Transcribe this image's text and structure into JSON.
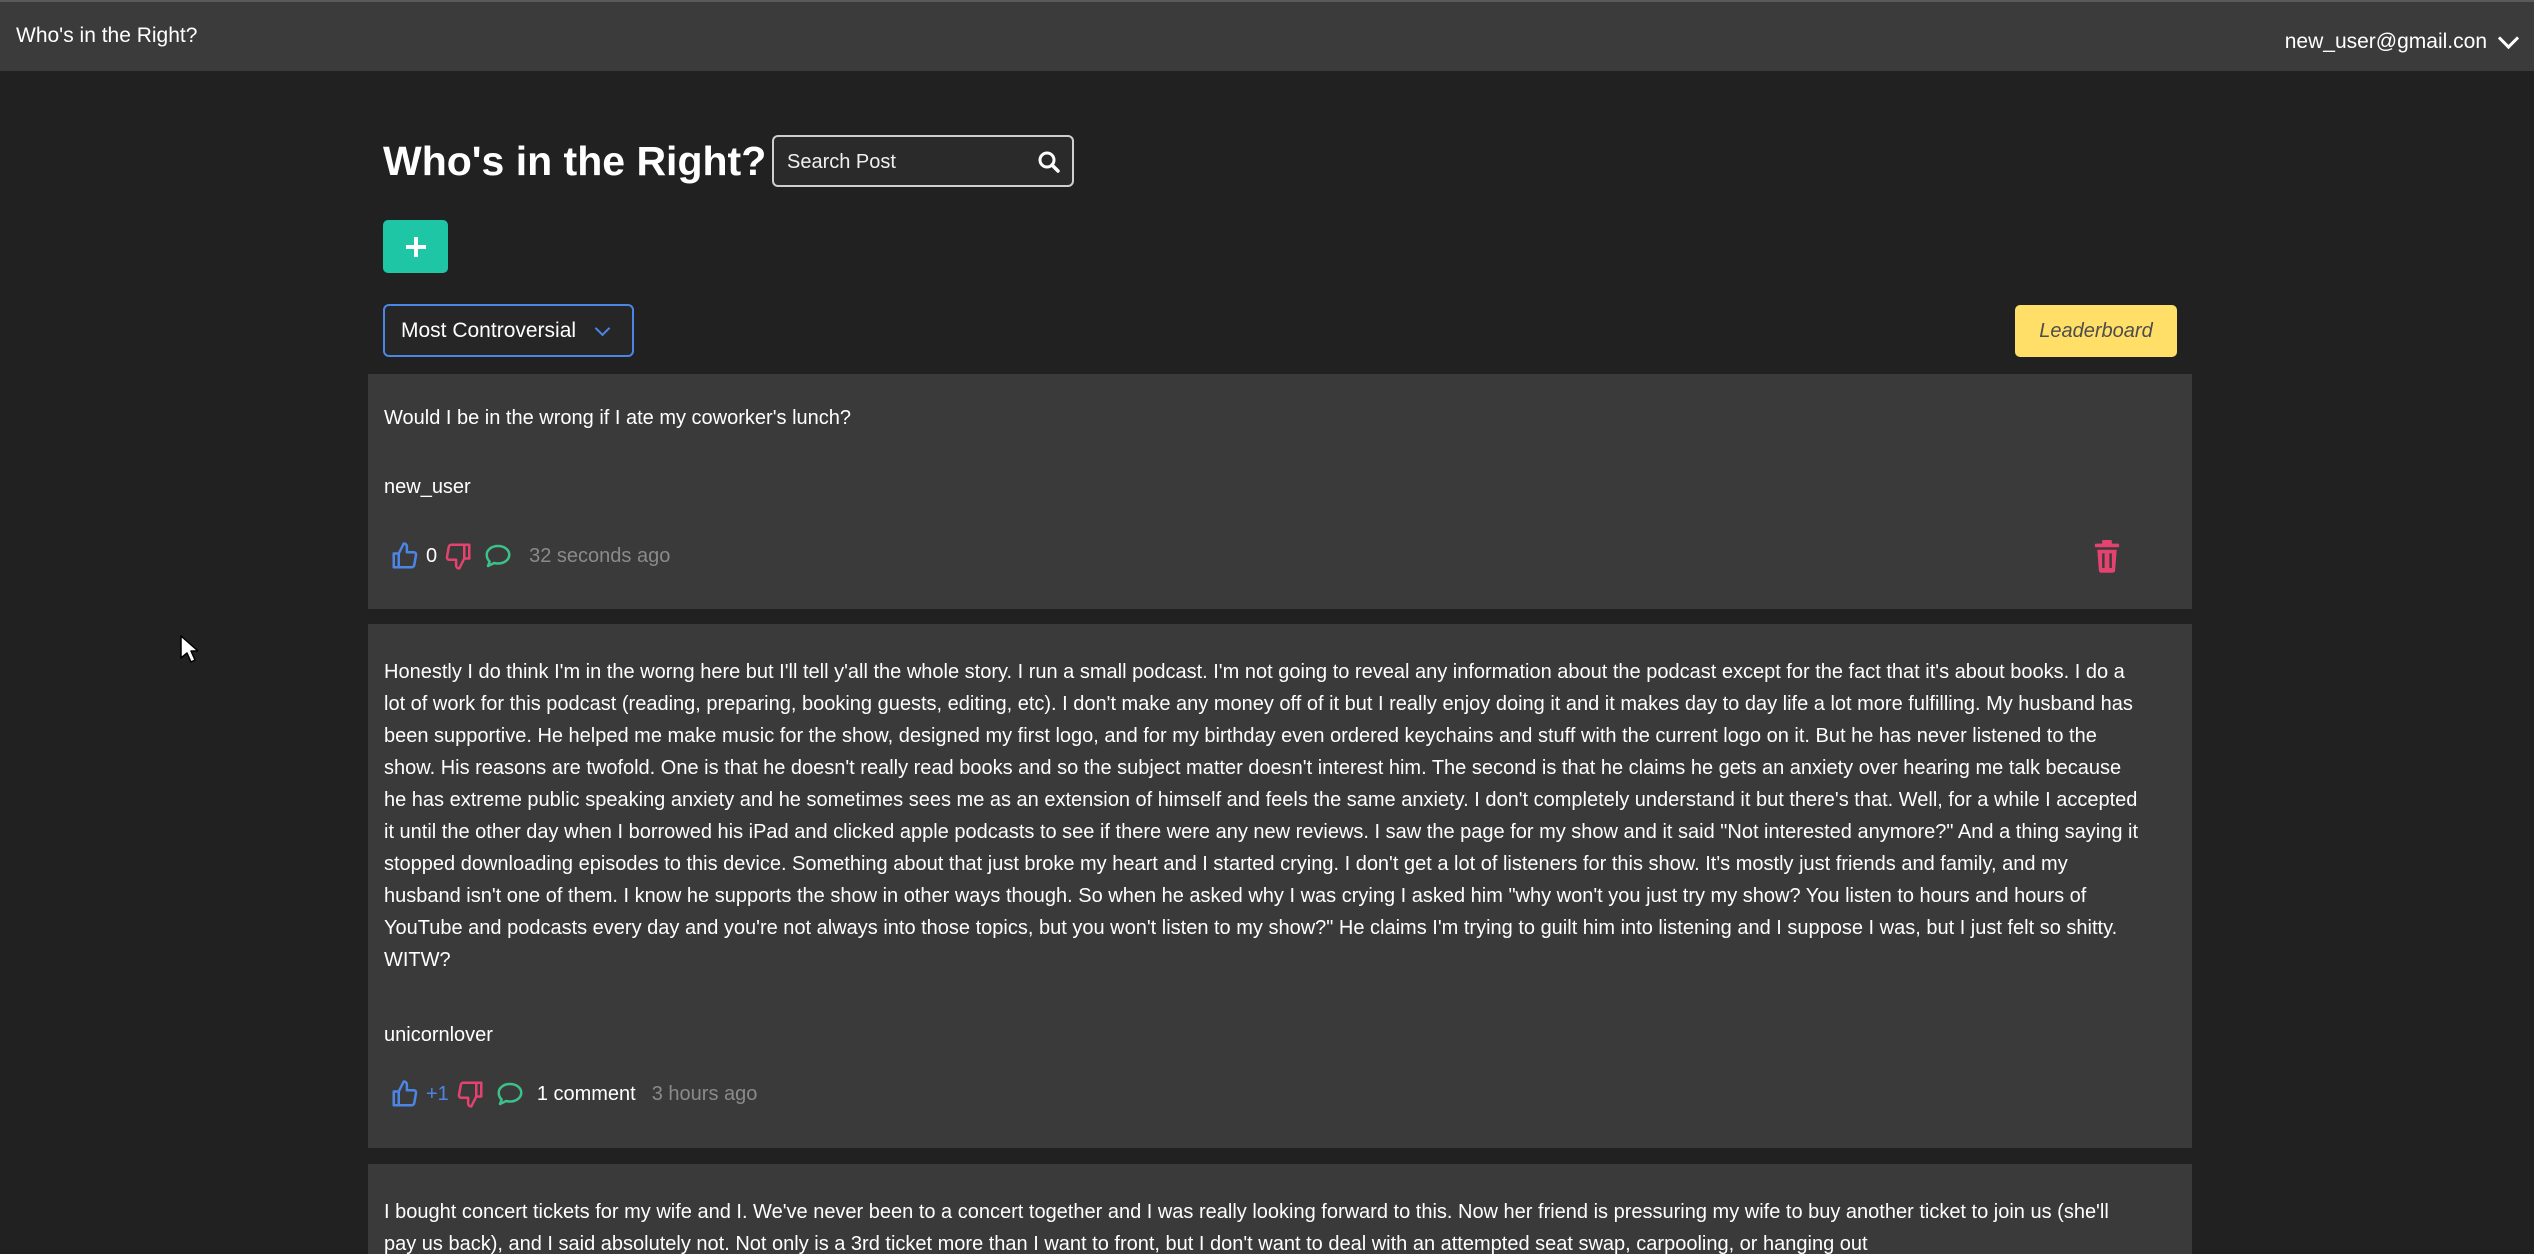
{
  "navbar": {
    "brand": "Who's in the Right?",
    "user_email": "new_user@gmail.con"
  },
  "header": {
    "title": "Who's in the Right?",
    "search_placeholder": "Search Post"
  },
  "controls": {
    "sort_selected": "Most Controversial",
    "leaderboard_label": "Leaderboard"
  },
  "colors": {
    "accent_teal": "#1fc6a5",
    "accent_yellow": "#ffdf68",
    "like_blue": "#4b86e6",
    "dislike_red": "#e4436f",
    "comment_green": "#3cc18a",
    "delete_red": "#e4436f"
  },
  "posts": [
    {
      "body": "Would I be in the wrong if I ate my coworker's lunch?",
      "author": "new_user",
      "score": "0",
      "comments": "",
      "time": "32 seconds ago",
      "deletable": true
    },
    {
      "body": "Honestly I do think I'm in the worng here but I'll tell y'all the whole story. I run a small podcast. I'm not going to reveal any information about the podcast except for the fact that it's about books. I do a lot of work for this podcast (reading, preparing, booking guests, editing, etc). I don't make any money off of it but I really enjoy doing it and it makes day to day life a lot more fulfilling. My husband has been supportive. He helped me make music for the show, designed my first logo, and for my birthday even ordered keychains and stuff with the current logo on it. But he has never listened to the show. His reasons are twofold. One is that he doesn't really read books and so the subject matter doesn't interest him. The second is that he claims he gets an anxiety over hearing me talk because he has extreme public speaking anxiety and he sometimes sees me as an extension of himself and feels the same anxiety. I don't completely understand it but there's that. Well, for a while I accepted it until the other day when I borrowed his iPad and clicked apple podcasts to see if there were any new reviews. I saw the page for my show and it said \"Not interested anymore?\" And a thing saying it stopped downloading episodes to this device. Something about that just broke my heart and I started crying. I don't get a lot of listeners for this show. It's mostly just friends and family, and my husband isn't one of them. I know he supports the show in other ways though. So when he asked why I was crying I asked him \"why won't you just try my show? You listen to hours and hours of YouTube and podcasts every day and you're not always into those topics, but you won't listen to my show?\" He claims I'm trying to guilt him into listening and I suppose I was, but I just felt so shitty. WITW?",
      "author": "unicornlover",
      "score": "+1",
      "comments": "1 comment",
      "time": "3 hours ago",
      "deletable": false
    },
    {
      "body": "I bought concert tickets for my wife and I. We've never been to a concert together and I was really looking forward to this. Now her friend is pressuring my wife to buy another ticket to join us (she'll pay us back), and I said absolutely not. Not only is a 3rd ticket more than I want to front, but I don't want to deal with an attempted seat swap, carpooling, or hanging out"
    }
  ]
}
